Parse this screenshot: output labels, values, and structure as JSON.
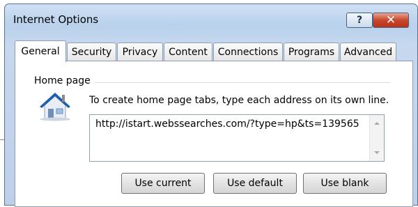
{
  "window": {
    "title": "Internet Options",
    "help_label": "?",
    "close_label": "✕"
  },
  "tabs": [
    "General",
    "Security",
    "Privacy",
    "Content",
    "Connections",
    "Programs",
    "Advanced"
  ],
  "home_page": {
    "group_label": "Home page",
    "description": "To create home page tabs, type each address on its own line.",
    "address": "http://istart.webssearches.com/?type=hp&ts=139565"
  },
  "buttons": {
    "use_current": "Use current",
    "use_default": "Use default",
    "use_blank": "Use blank"
  },
  "icons": [
    "house-icon",
    "help-icon",
    "close-icon",
    "scroll-up-icon",
    "scroll-down-icon"
  ]
}
